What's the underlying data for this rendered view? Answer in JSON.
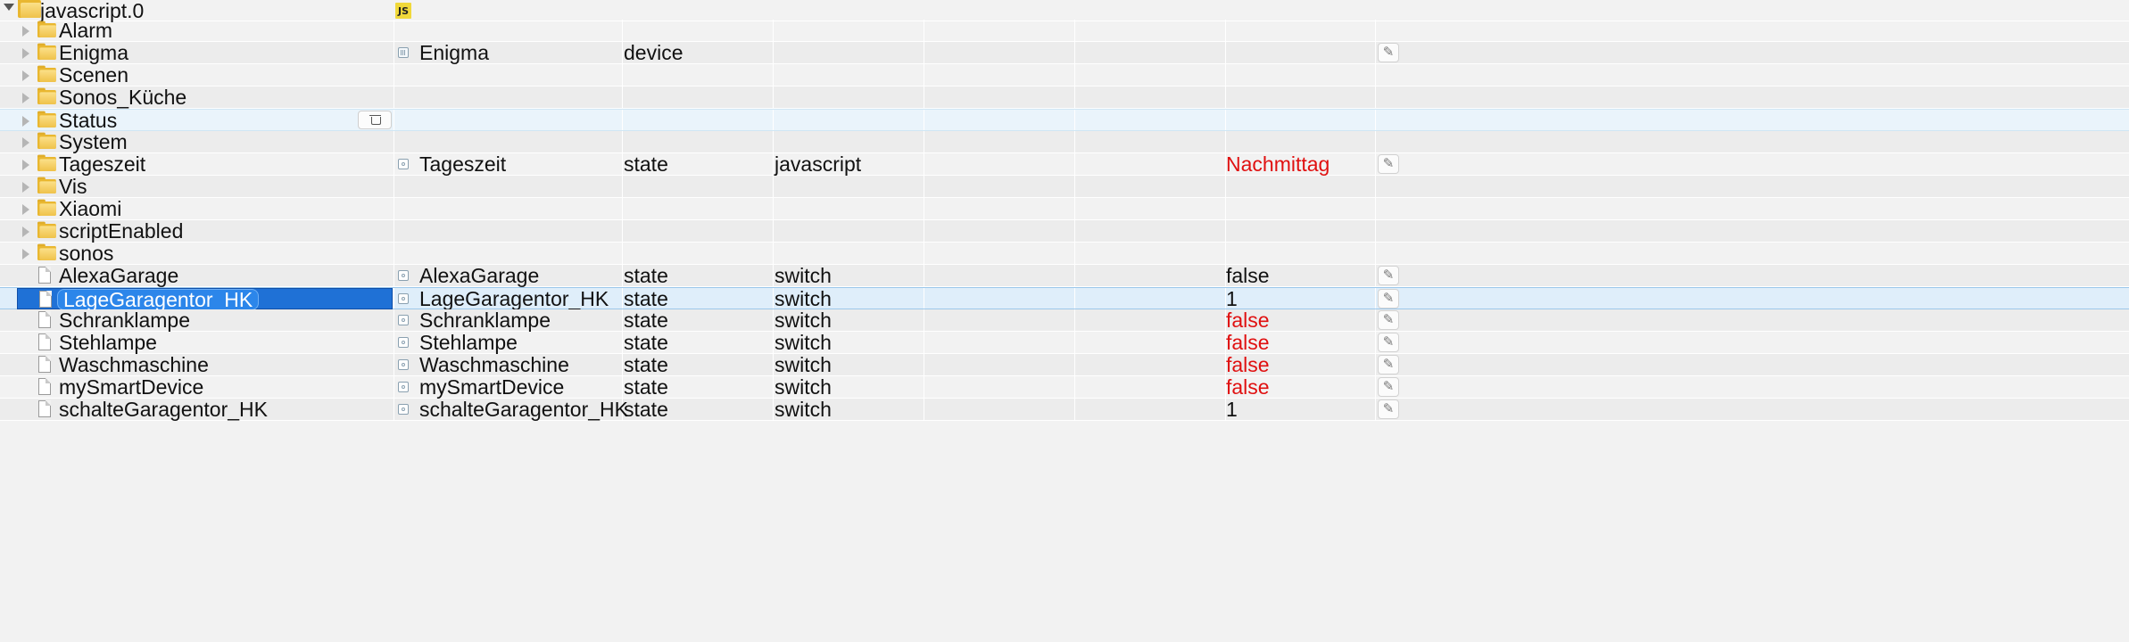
{
  "root": {
    "name": "javascript.0",
    "badge": "JS"
  },
  "rows": [
    {
      "kind": "folder",
      "name": "Alarm",
      "objname": "",
      "type": "",
      "role": "",
      "value": ""
    },
    {
      "kind": "folder",
      "name": "Enigma",
      "objname": "Enigma",
      "type": "device",
      "role": "",
      "value": "",
      "type_icon": "device-icon"
    },
    {
      "kind": "folder",
      "name": "Scenen",
      "objname": "",
      "type": "",
      "role": "",
      "value": ""
    },
    {
      "kind": "folder",
      "name": "Sonos_Küche",
      "objname": "",
      "type": "",
      "role": "",
      "value": ""
    },
    {
      "kind": "folder",
      "name": "Status",
      "objname": "",
      "type": "",
      "role": "",
      "value": "",
      "hover": true
    },
    {
      "kind": "folder",
      "name": "System",
      "objname": "",
      "type": "",
      "role": "",
      "value": ""
    },
    {
      "kind": "folder",
      "name": "Tageszeit",
      "objname": "Tageszeit",
      "type": "state",
      "role": "javascript",
      "value": "Nachmittag",
      "value_red": true
    },
    {
      "kind": "folder",
      "name": "Vis",
      "objname": "",
      "type": "",
      "role": "",
      "value": ""
    },
    {
      "kind": "folder",
      "name": "Xiaomi",
      "objname": "",
      "type": "",
      "role": "",
      "value": ""
    },
    {
      "kind": "folder",
      "name": "scriptEnabled",
      "objname": "",
      "type": "",
      "role": "",
      "value": ""
    },
    {
      "kind": "folder",
      "name": "sonos",
      "objname": "",
      "type": "",
      "role": "",
      "value": ""
    },
    {
      "kind": "file",
      "name": "AlexaGarage",
      "objname": "AlexaGarage",
      "type": "state",
      "role": "switch",
      "value": "false",
      "value_red": false
    },
    {
      "kind": "file",
      "name": "LageGaragentor_HK",
      "objname": "LageGaragentor_HK",
      "type": "state",
      "role": "switch",
      "value": "1",
      "value_red": false,
      "selected": true
    },
    {
      "kind": "file",
      "name": "Schranklampe",
      "objname": "Schranklampe",
      "type": "state",
      "role": "switch",
      "value": "false",
      "value_red": true
    },
    {
      "kind": "file",
      "name": "Stehlampe",
      "objname": "Stehlampe",
      "type": "state",
      "role": "switch",
      "value": "false",
      "value_red": true
    },
    {
      "kind": "file",
      "name": "Waschmaschine",
      "objname": "Waschmaschine",
      "type": "state",
      "role": "switch",
      "value": "false",
      "value_red": true
    },
    {
      "kind": "file",
      "name": "mySmartDevice",
      "objname": "mySmartDevice",
      "type": "state",
      "role": "switch",
      "value": "false",
      "value_red": true
    },
    {
      "kind": "file",
      "name": "schalteGaragentor_HK",
      "objname": "schalteGaragentor_HK",
      "type": "state",
      "role": "switch",
      "value": "1",
      "value_red": false
    }
  ],
  "icons": {
    "expander": "triangle-right-icon",
    "folder": "folder-icon",
    "file": "document-icon",
    "edit": "pencil-icon",
    "delete": "trash-icon",
    "state": "state-icon"
  },
  "colors": {
    "selection": "#1f71d6",
    "value_red": "#e01010",
    "hover_row": "#eaf4fb"
  }
}
